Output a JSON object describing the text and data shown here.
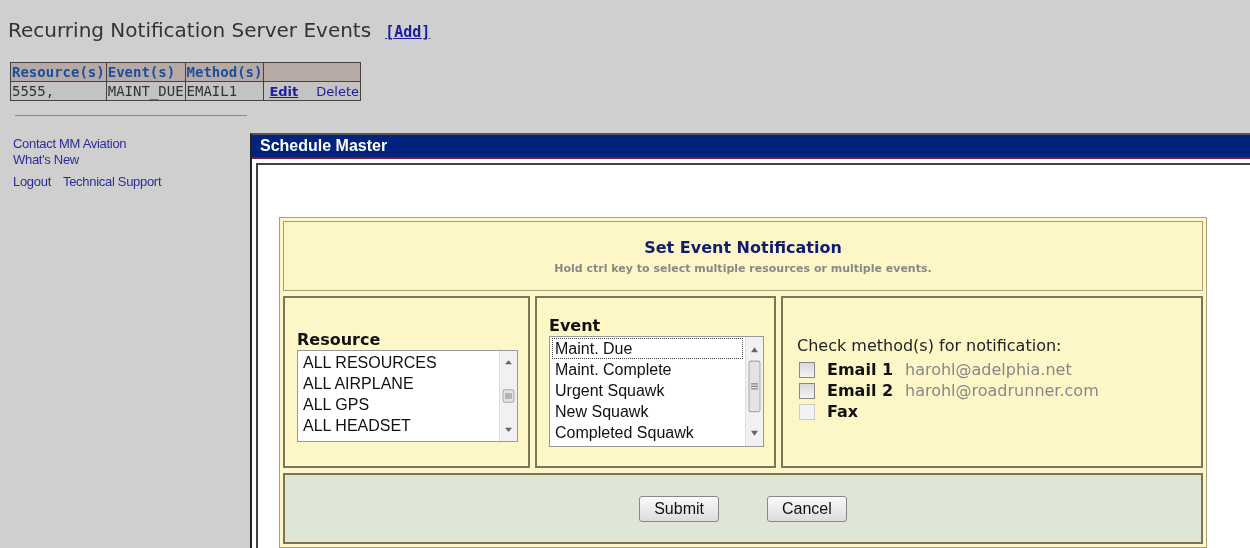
{
  "page": {
    "title": "Recurring Notification Server Events",
    "add_link": "[Add]"
  },
  "table": {
    "columns": [
      "Resource(s)",
      "Event(s)",
      "Method(s)"
    ],
    "rows": [
      {
        "cells": [
          "5555,",
          "MAINT_DUE",
          "EMAIL1"
        ],
        "actions": [
          "Edit",
          "Delete"
        ]
      }
    ]
  },
  "sidebar": {
    "links": [
      [
        "Contact MM Aviation"
      ],
      [
        "What's New"
      ],
      [
        "Logout",
        "Technical Support"
      ]
    ]
  },
  "dialog": {
    "title": "Schedule Master",
    "heading": "Set Event Notification",
    "hint": "Hold ctrl key to select multiple resources or multiple events.",
    "resource": {
      "label": "Resource",
      "options": [
        {
          "text": "ALL RESOURCES",
          "focused": false
        },
        {
          "text": "ALL AIRPLANE",
          "focused": false
        },
        {
          "text": "ALL GPS",
          "focused": false
        },
        {
          "text": "ALL HEADSET",
          "focused": false
        }
      ]
    },
    "event": {
      "label": "Event",
      "options": [
        {
          "text": "Maint. Due",
          "focused": true
        },
        {
          "text": "Maint. Complete",
          "focused": false
        },
        {
          "text": "Urgent Squawk",
          "focused": false
        },
        {
          "text": "New Squawk",
          "focused": false
        },
        {
          "text": "Completed Squawk",
          "focused": false
        }
      ]
    },
    "methods": {
      "prompt": "Check method(s) for notification:",
      "items": [
        {
          "label": "Email 1",
          "address": "harohl@adelphia.net",
          "checked": false,
          "disabled": false
        },
        {
          "label": "Email 2",
          "address": "harohl@roadrunner.com",
          "checked": false,
          "disabled": false
        },
        {
          "label": "Fax",
          "checked": false,
          "disabled": true
        }
      ]
    },
    "buttons": [
      "Submit",
      "Cancel"
    ]
  }
}
